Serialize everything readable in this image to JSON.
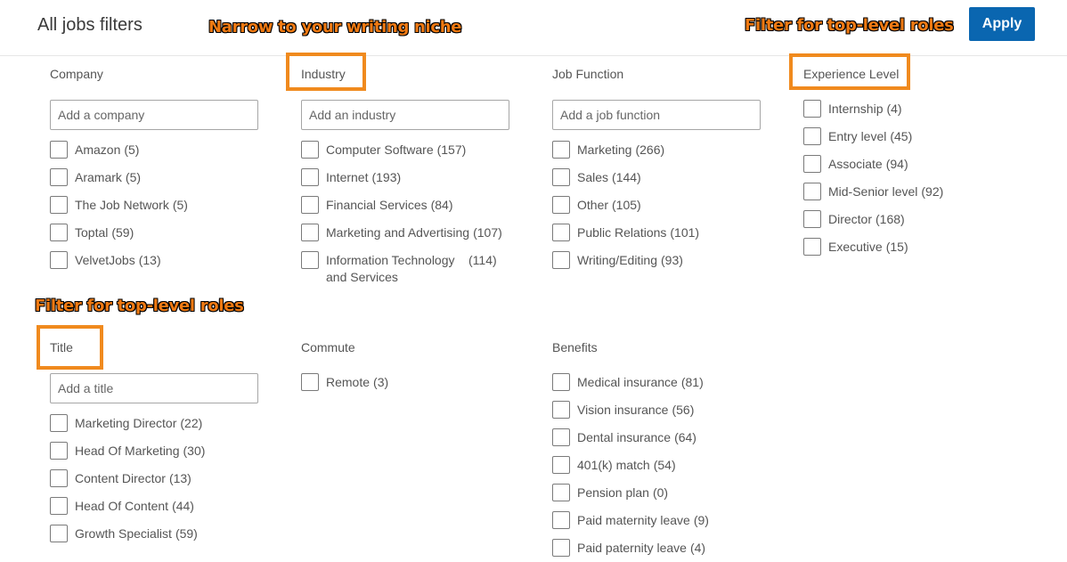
{
  "header": {
    "title": "All jobs filters",
    "apply_label": "Apply",
    "hidden_fragment": "○"
  },
  "annotations": {
    "industry_note": "Narrow to your writing niche",
    "experience_note": "Filter for top-level roles",
    "title_note": "Filter for top-level roles"
  },
  "colors": {
    "apply_bg": "#0a66b0",
    "annotation": "#f07a12",
    "highlight_border": "#f08a1e"
  },
  "company": {
    "heading": "Company",
    "placeholder": "Add a company",
    "options": [
      {
        "label": "Amazon",
        "count": "(5)"
      },
      {
        "label": "Aramark",
        "count": "(5)"
      },
      {
        "label": "The Job Network",
        "count": "(5)"
      },
      {
        "label": "Toptal",
        "count": "(59)"
      },
      {
        "label": "VelvetJobs",
        "count": "(13)"
      }
    ]
  },
  "industry": {
    "heading": "Industry",
    "placeholder": "Add an industry",
    "options": [
      {
        "label": "Computer Software",
        "count": "(157)"
      },
      {
        "label": "Internet",
        "count": "(193)"
      },
      {
        "label": "Financial Services",
        "count": "(84)"
      },
      {
        "label": "Marketing and Advertising",
        "count": "(107)"
      },
      {
        "label": "Information Technology and Services",
        "count": "(114)"
      }
    ]
  },
  "job_function": {
    "heading": "Job Function",
    "placeholder": "Add a job function",
    "options": [
      {
        "label": "Marketing",
        "count": "(266)"
      },
      {
        "label": "Sales",
        "count": "(144)"
      },
      {
        "label": "Other",
        "count": "(105)"
      },
      {
        "label": "Public Relations",
        "count": "(101)"
      },
      {
        "label": "Writing/Editing",
        "count": "(93)"
      }
    ]
  },
  "experience": {
    "heading": "Experience Level",
    "options": [
      {
        "label": "Internship",
        "count": "(4)"
      },
      {
        "label": "Entry level",
        "count": "(45)"
      },
      {
        "label": "Associate",
        "count": "(94)"
      },
      {
        "label": "Mid-Senior level",
        "count": "(92)"
      },
      {
        "label": "Director",
        "count": "(168)"
      },
      {
        "label": "Executive",
        "count": "(15)"
      }
    ]
  },
  "title_filter": {
    "heading": "Title",
    "placeholder": "Add a title",
    "options": [
      {
        "label": "Marketing Director",
        "count": "(22)"
      },
      {
        "label": "Head Of Marketing",
        "count": "(30)"
      },
      {
        "label": "Content Director",
        "count": "(13)"
      },
      {
        "label": "Head Of Content",
        "count": "(44)"
      },
      {
        "label": "Growth Specialist",
        "count": "(59)"
      }
    ]
  },
  "commute": {
    "heading": "Commute",
    "options": [
      {
        "label": "Remote",
        "count": "(3)"
      }
    ]
  },
  "benefits": {
    "heading": "Benefits",
    "options": [
      {
        "label": "Medical insurance",
        "count": "(81)"
      },
      {
        "label": "Vision insurance",
        "count": "(56)"
      },
      {
        "label": "Dental insurance",
        "count": "(64)"
      },
      {
        "label": "401(k) match",
        "count": "(54)"
      },
      {
        "label": "Pension plan",
        "count": "(0)"
      },
      {
        "label": "Paid maternity leave",
        "count": "(9)"
      },
      {
        "label": "Paid paternity leave",
        "count": "(4)"
      }
    ]
  }
}
